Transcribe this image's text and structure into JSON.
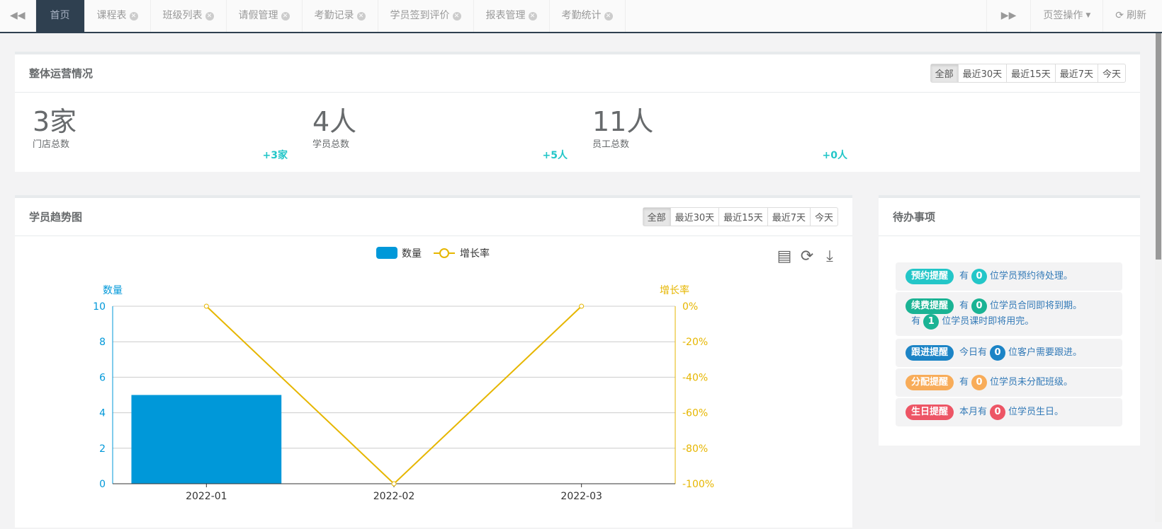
{
  "tabs": [
    {
      "label": "首页",
      "active": true
    },
    {
      "label": "课程表"
    },
    {
      "label": "班级列表"
    },
    {
      "label": "请假管理"
    },
    {
      "label": "考勤记录"
    },
    {
      "label": "学员签到评价"
    },
    {
      "label": "报表管理"
    },
    {
      "label": "考勤统计"
    }
  ],
  "tabbar": {
    "tab_ops": "页签操作",
    "refresh": "刷新"
  },
  "range_options": [
    "全部",
    "最近30天",
    "最近15天",
    "最近7天",
    "今天"
  ],
  "overview": {
    "title": "整体运营情况",
    "stats": [
      {
        "value": "3家",
        "label": "门店总数",
        "delta": "+3家"
      },
      {
        "value": "4人",
        "label": "学员总数",
        "delta": "+5人"
      },
      {
        "value": "11人",
        "label": "员工总数",
        "delta": "+0人"
      }
    ]
  },
  "trend": {
    "title": "学员趋势图"
  },
  "todo": {
    "title": "待办事项",
    "items": [
      {
        "tag": "预约提醒",
        "color": "#23c6c8",
        "lines": [
          [
            "有",
            "0",
            "位学员预约待处理。"
          ]
        ]
      },
      {
        "tag": "续费提醒",
        "color": "#1ab394",
        "lines": [
          [
            "有",
            "0",
            "位学员合同即将到期。"
          ],
          [
            "有",
            "1",
            "位学员课时即将用完。"
          ]
        ]
      },
      {
        "tag": "跟进提醒",
        "color": "#1c84c6",
        "lines": [
          [
            "今日有",
            "0",
            "位客户需要跟进。"
          ]
        ]
      },
      {
        "tag": "分配提醒",
        "color": "#f8ac59",
        "lines": [
          [
            "有",
            "0",
            "位学员未分配班级。"
          ]
        ]
      },
      {
        "tag": "生日提醒",
        "color": "#ed5565",
        "lines": [
          [
            "本月有",
            "0",
            "位学员生日。"
          ]
        ]
      }
    ]
  },
  "chart_data": {
    "type": "bar+line",
    "categories": [
      "2022-01",
      "2022-02",
      "2022-03"
    ],
    "series": [
      {
        "name": "数量",
        "type": "bar",
        "axis": "left",
        "color": "#0098d9",
        "values": [
          5,
          0,
          0
        ]
      },
      {
        "name": "增长率",
        "type": "line",
        "axis": "right",
        "color": "#e6b600",
        "values": [
          0,
          -100,
          0
        ]
      }
    ],
    "y_left": {
      "name": "数量",
      "range": [
        0,
        10
      ],
      "ticks": [
        "0",
        "2",
        "4",
        "6",
        "8",
        "10"
      ]
    },
    "y_right": {
      "name": "增长率",
      "range": [
        -100,
        0
      ],
      "ticks": [
        "-100%",
        "-80%",
        "-60%",
        "-40%",
        "-20%",
        "0%"
      ]
    },
    "legend": "top-center",
    "grid": true
  }
}
